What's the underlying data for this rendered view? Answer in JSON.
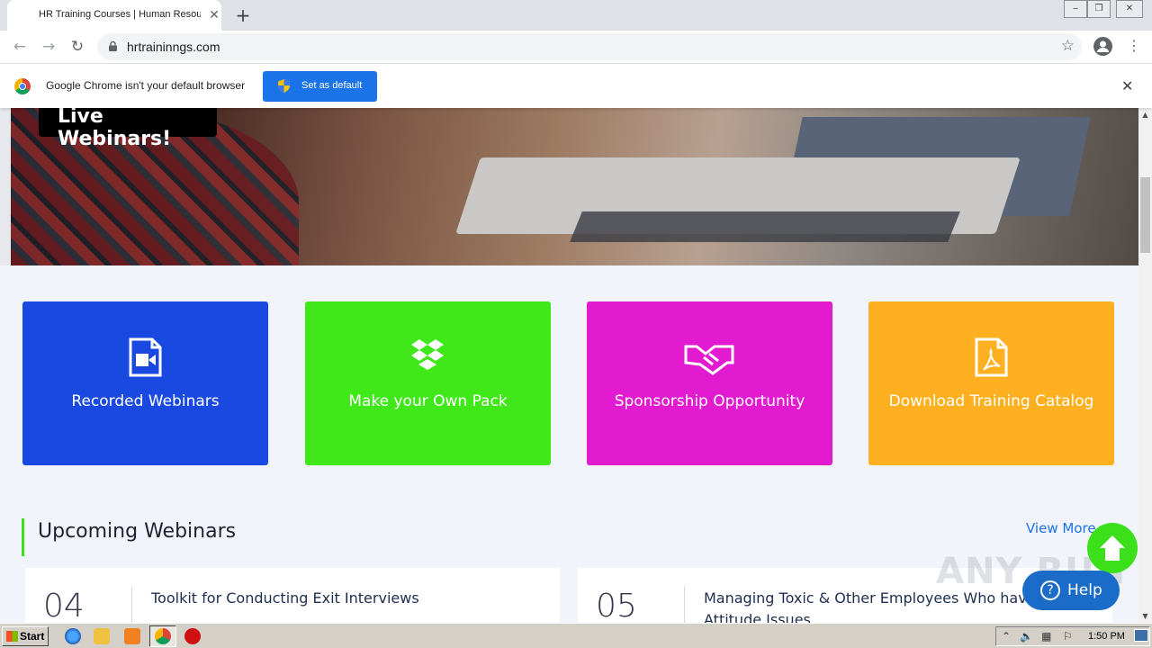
{
  "browser": {
    "tab_title": "HR Training Courses | Human Resources",
    "tab_close": "✕",
    "new_tab": "+",
    "url": "hrtraininngs.com",
    "window_controls": [
      "‒",
      "❐",
      "✕"
    ]
  },
  "infobar": {
    "message": "Google Chrome isn't your default browser",
    "button": "Set as default",
    "close": "✕"
  },
  "hero": {
    "badge": "Live Webinars!"
  },
  "cards": [
    {
      "label": "Recorded Webinars",
      "color": "#1949e0",
      "icon": "video-file-icon"
    },
    {
      "label": "Make your Own Pack",
      "color": "#40e81a",
      "icon": "dropbox-icon"
    },
    {
      "label": "Sponsorship Opportunity",
      "color": "#e21ad0",
      "icon": "handshake-icon"
    },
    {
      "label": "Download Training Catalog",
      "color": "#ffb020",
      "icon": "pdf-file-icon"
    }
  ],
  "upcoming": {
    "title": "Upcoming Webinars",
    "view_more": "View More",
    "items": [
      {
        "date": "04",
        "title": "Toolkit for Conducting Exit Interviews"
      },
      {
        "date": "05",
        "title": "Managing Toxic & Other Employees Who have Attitude Issues"
      }
    ]
  },
  "help": {
    "label": "Help",
    "icon_glyph": "?"
  },
  "watermark": "ANY RUN",
  "taskbar": {
    "start": "Start",
    "clock": "1:50 PM"
  }
}
